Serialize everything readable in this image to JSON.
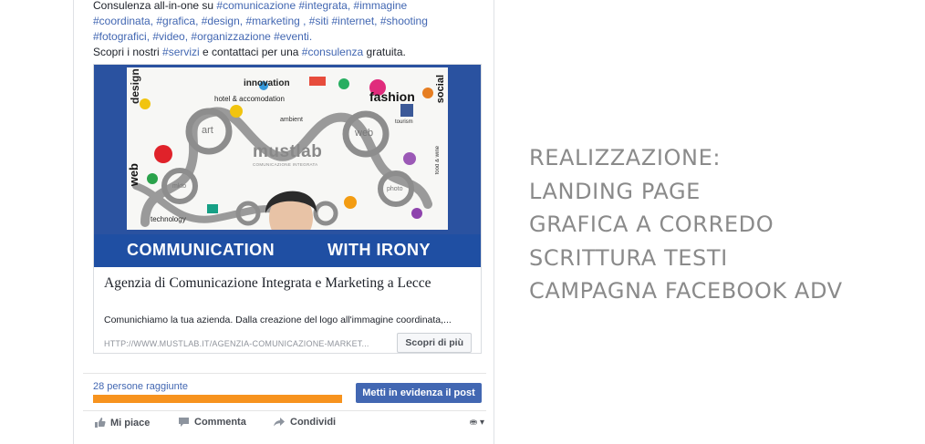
{
  "post": {
    "line1_prefix": "Consulenza all-in-one su ",
    "line1_tags": "#comunicazione #integrata, #immagine",
    "line2": "#coordinata, #grafica, #design, #marketing , #siti #internet, #shooting",
    "line3": "#fotografici, #video, #organizzazione #eventi.",
    "line4_prefix": "Scopri i nostri ",
    "line4_tag1": "#servizi",
    "line4_mid": " e contattaci per una ",
    "line4_tag2": "#consulenza",
    "line4_suffix": " gratuita."
  },
  "image": {
    "banner_left": "COMMUNICATION",
    "banner_right": "WITH IRONY",
    "words": {
      "design": "design",
      "innovation": "innovation",
      "hotel": "hotel & accomodation",
      "fashion": "fashion",
      "social": "social",
      "art": "art",
      "web": "web",
      "ambient": "ambient",
      "tourism": "tourism",
      "food": "food & wine",
      "web_side": "web",
      "brand": "mustlab",
      "brand_sub": "COMUNICAZIONE INTEGRATA",
      "mkto": "mkto",
      "photo": "photo",
      "technology": "technology"
    }
  },
  "link": {
    "title": "Agenzia di Comunicazione Integrata e Marketing a Lecce",
    "description": "Comunichiamo la tua azienda. Dalla creazione del logo all'immagine coordinata,...",
    "url": "HTTP://WWW.MUSTLAB.IT/AGENZIA-COMUNICAZIONE-MARKET...",
    "cta": "Scopri di più"
  },
  "reach": {
    "label": "28 persone raggiunte",
    "progress": 1.0,
    "boost_button": "Metti in evidenza il post"
  },
  "actions": {
    "like": "Mi piace",
    "comment": "Commenta",
    "share": "Condividi"
  },
  "side": {
    "lines": [
      "REALIZZAZIONE:",
      "LANDING PAGE",
      "GRAFICA A CORREDO",
      "SCRITTURA TESTI",
      "CAMPAGNA FACEBOOK ADV"
    ]
  },
  "colors": {
    "link_blue": "#4267b2",
    "banner_blue": "#1f4fa3",
    "reach_orange": "#f7931e",
    "side_gray": "#8a8a8a"
  }
}
